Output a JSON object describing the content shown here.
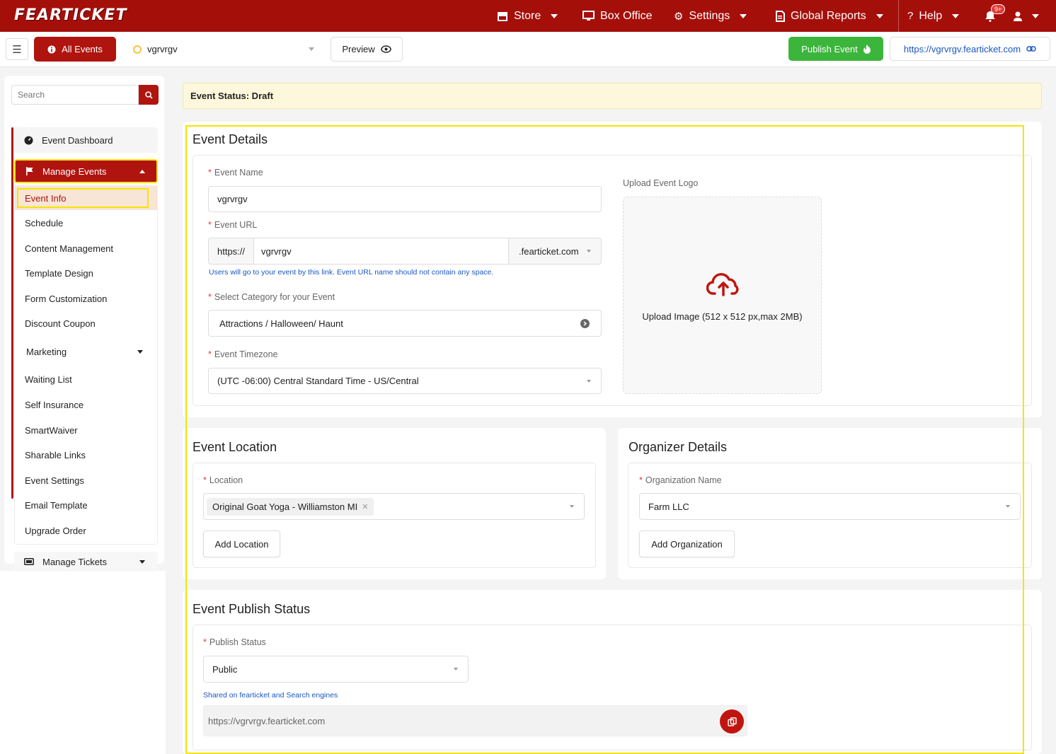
{
  "topbar": {
    "logo": "FEARTICKET",
    "nav": [
      {
        "label": "Store",
        "icon": "store-icon"
      },
      {
        "label": "Box Office",
        "icon": "monitor-icon"
      },
      {
        "label": "Settings",
        "icon": "gear-icon"
      },
      {
        "label": "Global Reports",
        "icon": "report-icon"
      },
      {
        "label": "Help",
        "icon": "question-icon"
      }
    ],
    "notification_badge": "9+"
  },
  "subbar": {
    "all_events_label": "All Events",
    "event_selector_value": "vgrvrgv",
    "preview_label": "Preview",
    "publish_label": "Publish Event",
    "event_url": "https://vgrvrgv.fearticket.com"
  },
  "sidebar": {
    "search_placeholder": "Search",
    "dashboard_label": "Event Dashboard",
    "manage_events_label": "Manage Events",
    "items": [
      "Event Info",
      "Schedule",
      "Content Management",
      "Template Design",
      "Form Customization",
      "Discount Coupon",
      "Marketing",
      "Waiting List",
      "Self Insurance",
      "SmartWaiver",
      "Sharable Links",
      "Event Settings",
      "Email Template",
      "Upgrade Order"
    ],
    "manage_tickets_label": "Manage Tickets"
  },
  "status_bar": "Event Status: Draft",
  "event_details": {
    "title": "Event Details",
    "event_name_label": "Event Name",
    "event_name_value": "vgrvrgv",
    "event_url_label": "Event URL",
    "url_prefix": "https://",
    "url_value": "vgrvrgv",
    "url_domain": ".fearticket.com",
    "url_hint": "Users will go to your event by this link. Event URL name should not contain any space.",
    "category_label": "Select Category for your Event",
    "category_value": "Attractions / Halloween/ Haunt",
    "timezone_label": "Event Timezone",
    "timezone_value": "(UTC -06:00) Central Standard Time - US/Central",
    "upload_logo_label": "Upload Event Logo",
    "upload_text": "Upload Image (512 x 512 px,max 2MB)"
  },
  "event_location": {
    "title": "Event Location",
    "location_label": "Location",
    "location_tag": "Original Goat Yoga - Williamston MI",
    "add_location_label": "Add Location"
  },
  "organizer_details": {
    "title": "Organizer Details",
    "org_name_label": "Organization Name",
    "org_name_value": "Farm LLC",
    "add_org_label": "Add Organization"
  },
  "publish_status": {
    "title": "Event Publish Status",
    "status_label": "Publish Status",
    "status_value": "Public",
    "hint": "Shared on fearticket and Search engines",
    "share_url": "https://vgrvrgv.fearticket.com"
  },
  "colors": {
    "brand_red": "#a50f0a",
    "publish_green": "#3cb53c",
    "link_blue": "#1a56c4",
    "highlight_yellow": "#f5e400"
  }
}
